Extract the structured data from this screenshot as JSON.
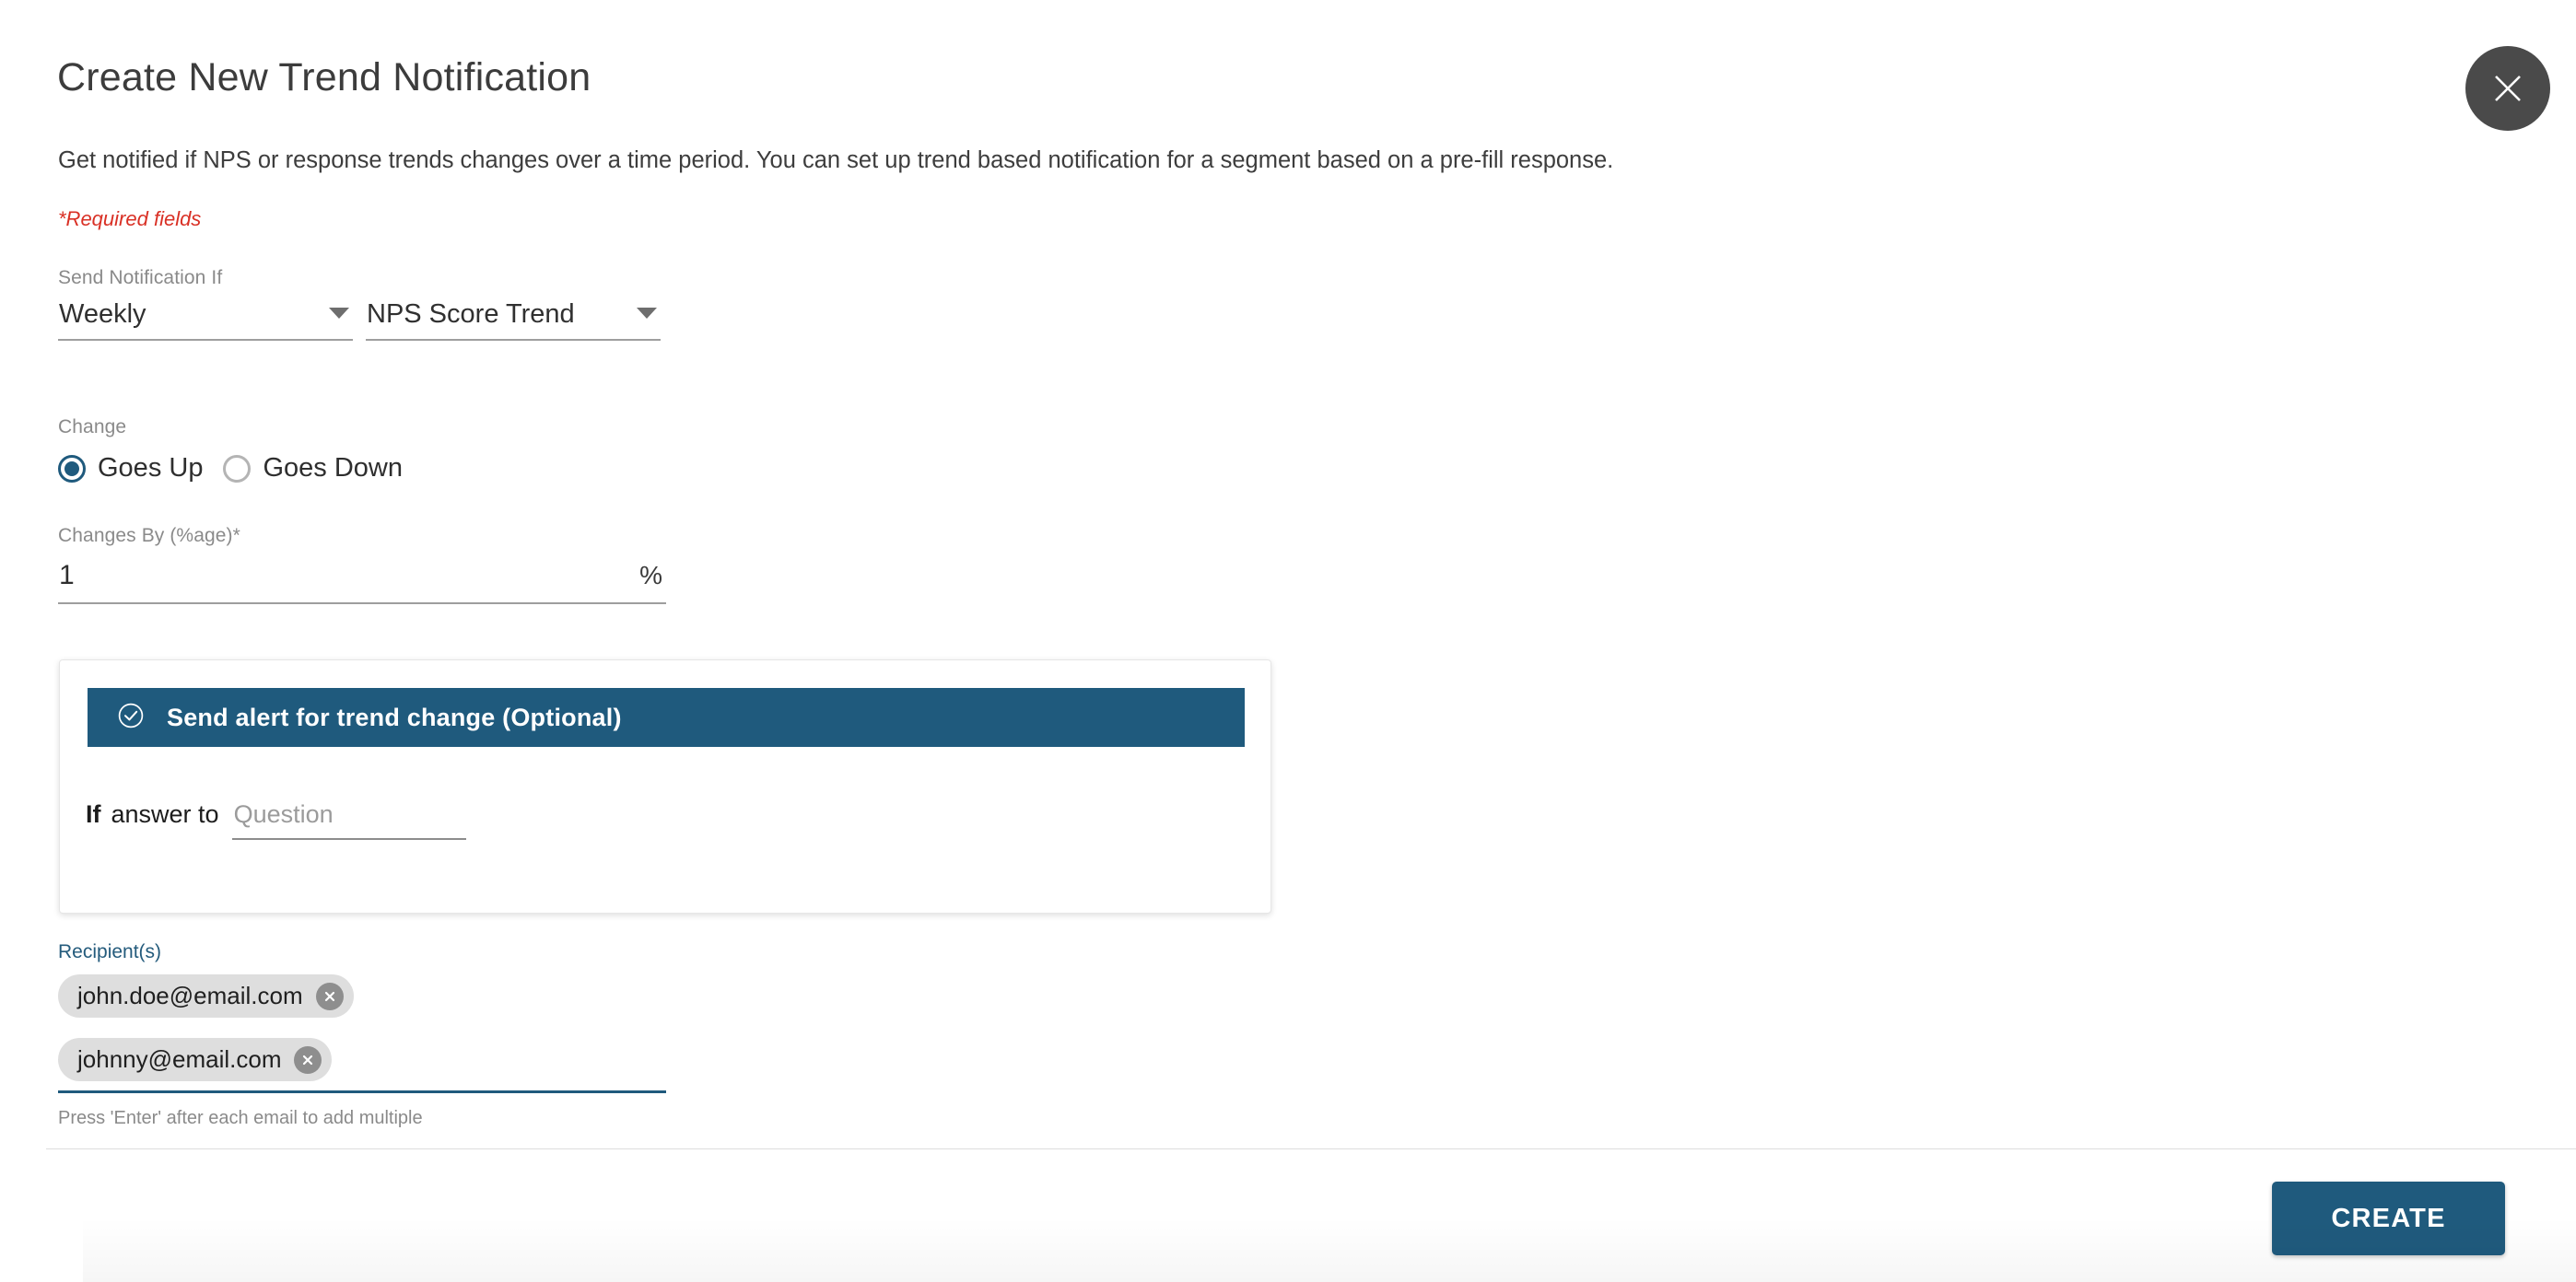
{
  "header": {
    "title": "Create New Trend Notification",
    "description": "Get notified if NPS or response trends changes over a time period. You can set up trend based notification for a segment based on a pre-fill response.",
    "required_note": "*Required fields",
    "close_icon": "close-icon"
  },
  "form": {
    "send_notification_if": {
      "label": "Send Notification If",
      "frequency_value": "Weekly",
      "metric_value": "NPS Score Trend",
      "caret_icon": "chevron-down-icon"
    },
    "change": {
      "label": "Change",
      "options": [
        {
          "label": "Goes Up",
          "selected": true
        },
        {
          "label": "Goes Down",
          "selected": false
        }
      ]
    },
    "changes_by": {
      "label": "Changes By (%age)*",
      "value": "1",
      "unit": "%"
    }
  },
  "alert_panel": {
    "banner_label": "Send alert for trend change (Optional)",
    "banner_icon": "check-circle-icon",
    "condition_prefix_bold": "If",
    "condition_prefix": "answer to",
    "question_placeholder": "Question",
    "question_value": ""
  },
  "recipients": {
    "label": "Recipient(s)",
    "chips": [
      {
        "email": "john.doe@email.com",
        "remove_icon": "close-circle-icon"
      },
      {
        "email": "johnny@email.com",
        "remove_icon": "close-circle-icon"
      }
    ],
    "helper": "Press 'Enter' after each email to add multiple"
  },
  "footer": {
    "create_label": "CREATE"
  },
  "colors": {
    "accent": "#1f5a7d",
    "required_red": "#d93025",
    "close_button_bg": "#4a4a4a",
    "chip_bg": "#dedede"
  }
}
